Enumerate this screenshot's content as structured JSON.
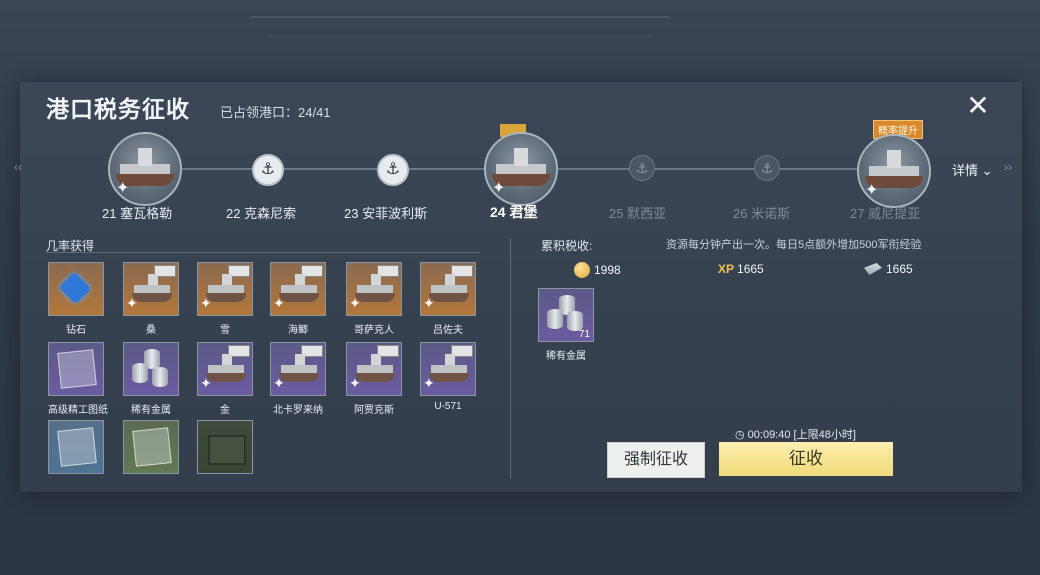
{
  "header": {
    "title": "港口税务征收",
    "occupied_label": "已占领港口：24/41",
    "close_label": "✕"
  },
  "timeline": {
    "details_label": "详情",
    "badge": "概率提升",
    "ports": [
      {
        "label": "21 塞瓦格勒",
        "state": "captured"
      },
      {
        "label": "22 克森尼索",
        "state": "captured"
      },
      {
        "label": "23 安菲波利斯",
        "state": "captured"
      },
      {
        "label": "24 君堡",
        "state": "current"
      },
      {
        "label": "25 默西亚",
        "state": "locked"
      },
      {
        "label": "26 米诺斯",
        "state": "locked"
      },
      {
        "label": "27 威尼提亚",
        "state": "locked"
      }
    ]
  },
  "drops": {
    "heading": "几率获得",
    "items": [
      {
        "label": "钻石",
        "icon": "diamond-icon",
        "rarity": "orange"
      },
      {
        "label": "桑",
        "icon": "ship-icon",
        "rarity": "orange"
      },
      {
        "label": "雪",
        "icon": "ship-icon",
        "rarity": "orange"
      },
      {
        "label": "海鲫",
        "icon": "ship-icon",
        "rarity": "orange"
      },
      {
        "label": "哥萨克人",
        "icon": "ship-icon",
        "rarity": "orange"
      },
      {
        "label": "吕佐夫",
        "icon": "ship-icon",
        "rarity": "orange"
      },
      {
        "label": "高级精工图纸",
        "icon": "blueprint-icon",
        "rarity": "purple"
      },
      {
        "label": "稀有金属",
        "icon": "metal-icon",
        "rarity": "purple"
      },
      {
        "label": "金",
        "icon": "ship-icon",
        "rarity": "purple"
      },
      {
        "label": "北卡罗来纳",
        "icon": "ship-icon",
        "rarity": "purple"
      },
      {
        "label": "阿贾克斯",
        "icon": "ship-icon",
        "rarity": "purple"
      },
      {
        "label": "U-571",
        "icon": "ship-icon",
        "rarity": "purple"
      },
      {
        "label": "",
        "icon": "blueprint-icon",
        "rarity": "blue"
      },
      {
        "label": "",
        "icon": "blueprint-icon",
        "rarity": "green"
      },
      {
        "label": "",
        "icon": "crate-icon",
        "rarity": "dark"
      }
    ]
  },
  "tax": {
    "heading": "累积税收:",
    "info": "资源每分钟产出一次。每日5点额外增加500军衔经验",
    "coins": "1998",
    "xp_icon_text": "XP",
    "xp": "1665",
    "rank_xp": "1665",
    "reward_label": "稀有金属",
    "reward_qty": "71",
    "timer": "◷ 00:09:40 [上限48小时]",
    "force_button": "强制征收",
    "collect_button": "征收"
  }
}
